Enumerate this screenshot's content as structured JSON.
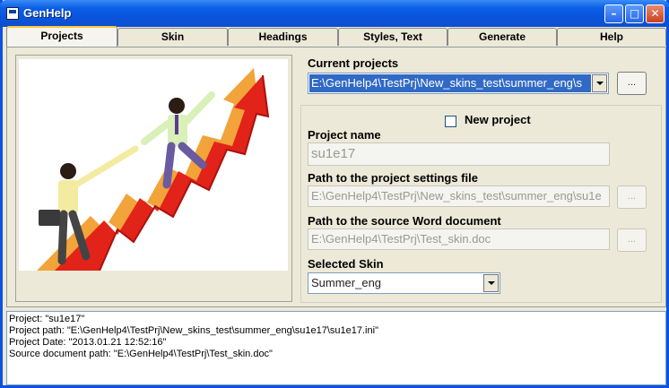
{
  "window": {
    "title": "GenHelp"
  },
  "tabs": [
    {
      "label": "Projects",
      "active": true
    },
    {
      "label": "Skin"
    },
    {
      "label": "Headings"
    },
    {
      "label": "Styles, Text"
    },
    {
      "label": "Generate"
    },
    {
      "label": "Help"
    }
  ],
  "projects": {
    "current_label": "Current projects",
    "current_value": "E:\\GenHelp4\\TestPrj\\New_skins_test\\summer_eng\\s",
    "browse_label": "...",
    "new_project_label": "New project",
    "new_project_checked": false,
    "name_label": "Project name",
    "name_value": "su1e17",
    "settings_label": "Path to the project settings file",
    "settings_value": "E:\\GenHelp4\\TestPrj\\New_skins_test\\summer_eng\\su1e",
    "source_label": "Path to the source Word document",
    "source_value": "E:\\GenHelp4\\TestPrj\\Test_skin.doc",
    "skin_label": "Selected Skin",
    "skin_value": "Summer_eng"
  },
  "log": [
    "Project: \"su1e17\"",
    "Project path: \"E:\\GenHelp4\\TestPrj\\New_skins_test\\summer_eng\\su1e17\\su1e17.ini\"",
    "Project Date: \"2013.01.21 12:52:16\"",
    "Source document path: \"E:\\GenHelp4\\TestPrj\\Test_skin.doc\""
  ],
  "colors": {
    "title_bar": "#0A55DE",
    "selection": "#316AC5",
    "window_bg": "#ECE9D8",
    "tab_highlight": "#FFC83C"
  },
  "icons": [
    "app-icon",
    "minimize-icon",
    "maximize-icon",
    "close-icon",
    "dropdown-arrow-icon",
    "checkbox-icon"
  ]
}
